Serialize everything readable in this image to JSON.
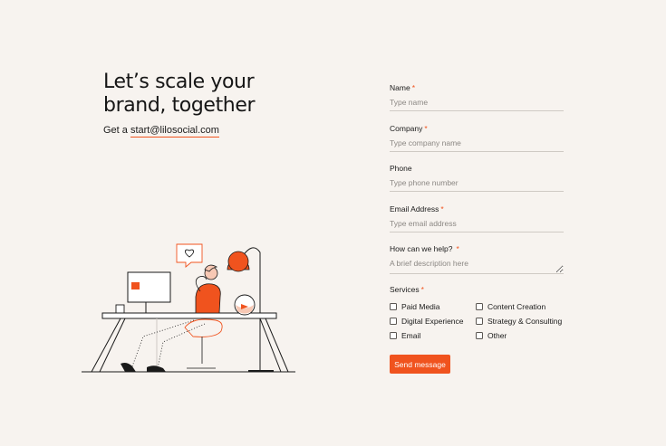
{
  "hero": {
    "title": "Let’s scale your\nbrand, together",
    "contact_prefix": "Get a ",
    "contact_email": "start@lilosocial.com"
  },
  "form": {
    "name": {
      "label": "Name",
      "required": "*",
      "placeholder": "Type name"
    },
    "company": {
      "label": "Company",
      "required": "*",
      "placeholder": "Type company name"
    },
    "phone": {
      "label": "Phone",
      "placeholder": "Type phone number"
    },
    "email": {
      "label": "Email Address",
      "required": "*",
      "placeholder": "Type email address"
    },
    "help": {
      "label": "How can we help?",
      "required": "*",
      "placeholder": "A brief description here"
    },
    "services": {
      "label": "Services",
      "required": "*",
      "options": [
        "Paid Media",
        "Content Creation",
        "Digital Experience",
        "Strategy & Consulting",
        "Email",
        "Other"
      ]
    },
    "submit_label": "Send message"
  },
  "colors": {
    "accent": "#f0531e",
    "background": "#f7f3ef",
    "text": "#1a1a1a"
  }
}
